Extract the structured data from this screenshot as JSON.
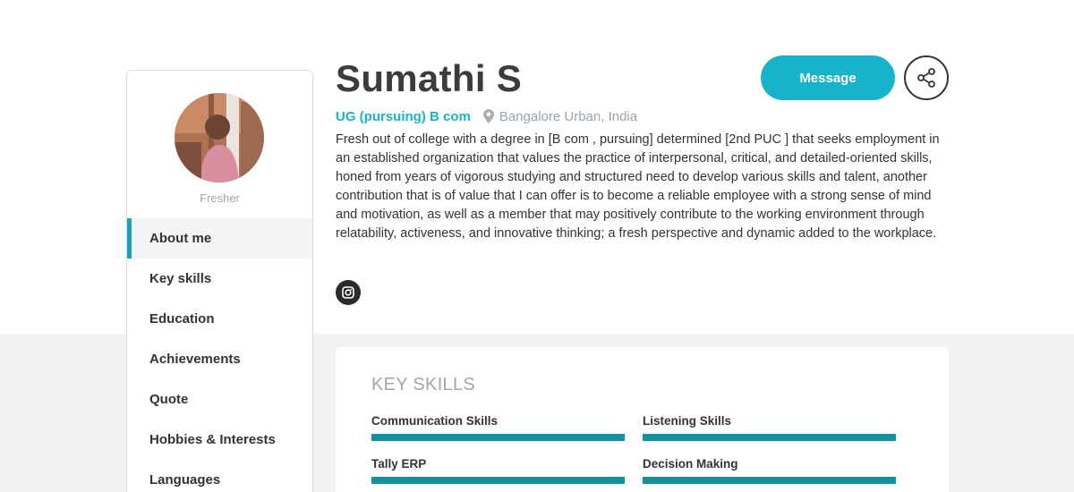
{
  "profile": {
    "name": "Sumathi S",
    "degree": "UG (pursuing) B com",
    "location": "Bangalore Urban, India",
    "status": "Fresher",
    "bio": "Fresh out of college with a degree in [B com , pursuing] determined [2nd PUC ] that seeks employment in an established organization that values the practice of interpersonal, critical, and detailed-oriented skills, honed from years of vigorous studying and structured need to develop various skills and talent, another contribution that is of value that I can offer is to become a reliable employee with a strong sense of mind and motivation, as well as a member that may positively contribute to the working environment through relatability, activeness, and innovative thinking; a fresh perspective and dynamic added to the workplace."
  },
  "actions": {
    "message_label": "Message",
    "share_icon": "share-icon",
    "social_icon": "instagram-icon"
  },
  "sidebar": {
    "items": [
      {
        "label": "About me",
        "active": true
      },
      {
        "label": "Key skills",
        "active": false
      },
      {
        "label": "Education",
        "active": false
      },
      {
        "label": "Achievements",
        "active": false
      },
      {
        "label": "Quote",
        "active": false
      },
      {
        "label": "Hobbies & Interests",
        "active": false
      },
      {
        "label": "Languages",
        "active": false
      }
    ]
  },
  "key_skills": {
    "title": "KEY SKILLS",
    "skills": [
      {
        "name": "Communication Skills",
        "level": 1.0
      },
      {
        "name": "Listening Skills",
        "level": 1.0
      },
      {
        "name": "Tally ERP",
        "level": 1.0
      },
      {
        "name": "Decision Making",
        "level": 1.0
      }
    ]
  },
  "colors": {
    "accent": "#17b3c9",
    "skill_bar": "#138f9e",
    "degree_text": "#1ab3c4"
  }
}
